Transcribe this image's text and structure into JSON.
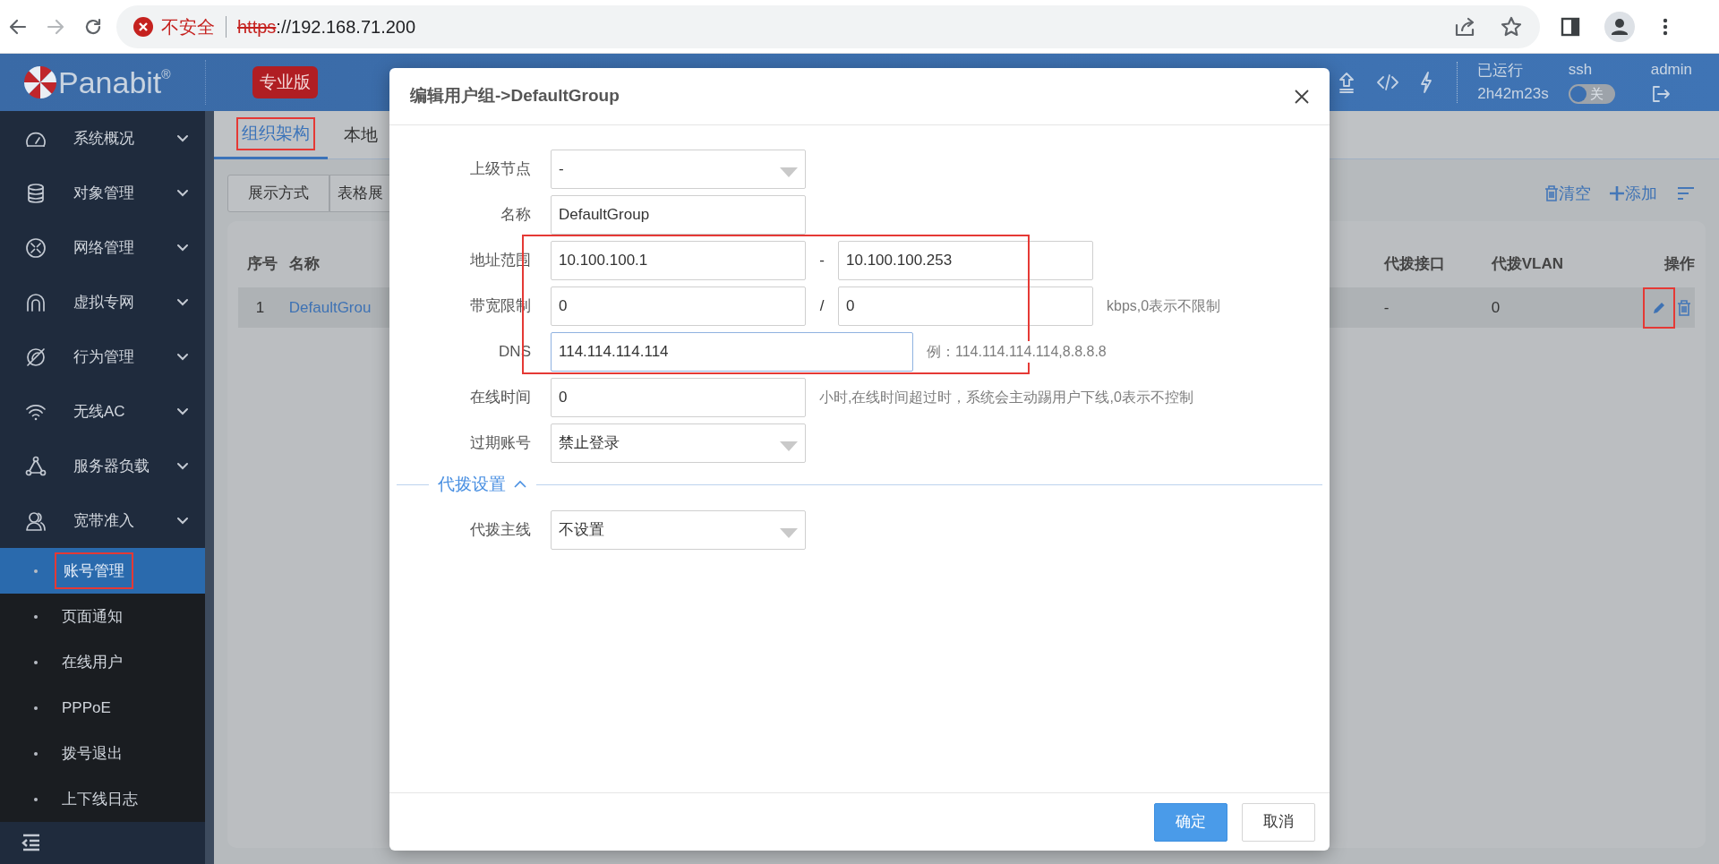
{
  "browser": {
    "security": "不安全",
    "url_scheme": "https",
    "url_rest": "://192.168.71.200"
  },
  "header": {
    "brand": "Panabit",
    "registered": "®",
    "edition": "专业版",
    "uptime_label": "已运行",
    "uptime": "2h42m23s",
    "ssh_label": "ssh",
    "ssh_toggle": {
      "on": false,
      "label": "关"
    },
    "user": "admin"
  },
  "sidebar": {
    "items": [
      {
        "label": "系统概况"
      },
      {
        "label": "对象管理"
      },
      {
        "label": "网络管理"
      },
      {
        "label": "虚拟专网"
      },
      {
        "label": "行为管理"
      },
      {
        "label": "无线AC"
      },
      {
        "label": "服务器负载"
      },
      {
        "label": "宽带准入",
        "children": [
          {
            "label": "账号管理",
            "selected": true,
            "highlighted": true
          },
          {
            "label": "页面通知",
            "selected": false,
            "highlighted": false
          },
          {
            "label": "在线用户",
            "selected": false,
            "highlighted": false
          },
          {
            "label": "PPPoE",
            "selected": false,
            "highlighted": false
          },
          {
            "label": "拨号退出",
            "selected": false,
            "highlighted": false
          },
          {
            "label": "上下线日志",
            "selected": false,
            "highlighted": false
          }
        ]
      }
    ]
  },
  "tabs": [
    {
      "label": "组织架构",
      "selected": true,
      "highlighted": true
    },
    {
      "label": "本地",
      "selected": false,
      "highlighted": false
    }
  ],
  "toolbar": {
    "view_label": "展示方式",
    "view_value": "表格展",
    "clear": "清空",
    "add": "添加"
  },
  "table": {
    "columns": [
      "序号",
      "名称",
      "代拨接口",
      "代拨VLAN",
      "操作"
    ],
    "rows": [
      {
        "cells": [
          "1",
          "DefaultGrou",
          "-",
          "0"
        ],
        "edit_highlighted": true
      }
    ]
  },
  "dialog": {
    "title": "编辑用户组->DefaultGroup",
    "fields": [
      {
        "label": "上级节点",
        "kind": "select",
        "value": "-",
        "highlighted": false
      },
      {
        "label": "名称",
        "kind": "text",
        "value": "DefaultGroup",
        "highlighted": false
      },
      {
        "label": "地址范围",
        "kind": "range",
        "value": "10.100.100.1",
        "separator": "-",
        "value2": "10.100.100.253",
        "highlighted": true
      },
      {
        "label": "带宽限制",
        "kind": "range",
        "value": "0",
        "separator": "/",
        "value2": "0",
        "hint": "kbps,0表示不限制",
        "highlighted": true
      },
      {
        "label": "DNS",
        "kind": "wide",
        "value": "114.114.114.114",
        "hint": "例：114.114.114.114,8.8.8.8",
        "focused": true,
        "highlighted": true
      },
      {
        "label": "在线时间",
        "kind": "text",
        "value": "0",
        "hint": "小时,在线时间超过时，系统会主动踢用户下线,0表示不控制",
        "highlighted": false
      },
      {
        "label": "过期账号",
        "kind": "select",
        "value": "禁止登录",
        "highlighted": false
      }
    ],
    "section": {
      "label": "代拨设置",
      "expanded": true,
      "fields": [
        {
          "label": "代拨主线",
          "kind": "select",
          "value": "不设置",
          "highlighted": false
        }
      ]
    },
    "buttons": [
      {
        "label": "确定",
        "kind": "primary"
      },
      {
        "label": "取消",
        "kind": "default"
      }
    ]
  }
}
